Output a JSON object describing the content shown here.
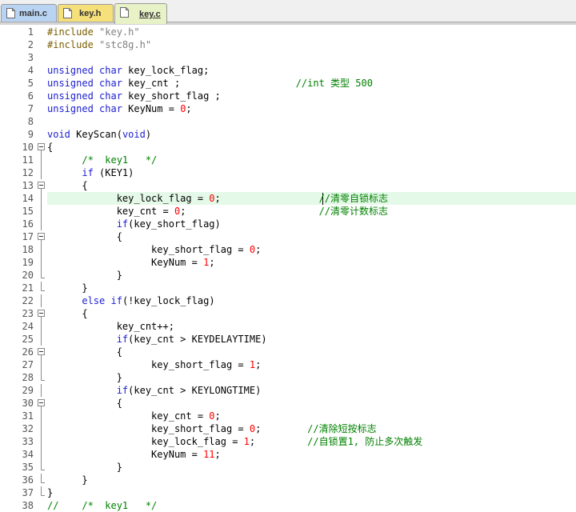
{
  "tabs": [
    {
      "label": "main.c",
      "color": "#b9d3f2",
      "active": false
    },
    {
      "label": "key.h",
      "color": "#f6e07a",
      "active": false
    },
    {
      "label": "key.c",
      "color": "#e7f2c6",
      "active": true
    }
  ],
  "current_line": 14,
  "colors": {
    "keyword": "#1e20d0",
    "preprocessor": "#7a5d00",
    "string": "#808080",
    "number": "#ff0000",
    "comment": "#008000",
    "current_line_bg": "#e5f9e8"
  },
  "code_lines": [
    {
      "n": "1",
      "fold": "",
      "text": "#include \"key.h\""
    },
    {
      "n": "2",
      "fold": "",
      "text": "#include \"stc8g.h\""
    },
    {
      "n": "3",
      "fold": "",
      "text": ""
    },
    {
      "n": "4",
      "fold": "",
      "text": "unsigned char key_lock_flag;"
    },
    {
      "n": "5",
      "fold": "",
      "text": "unsigned char key_cnt ;                    //int 类型 500"
    },
    {
      "n": "6",
      "fold": "",
      "text": "unsigned char key_short_flag ;"
    },
    {
      "n": "7",
      "fold": "",
      "text": "unsigned char KeyNum = 0;"
    },
    {
      "n": "8",
      "fold": "",
      "text": ""
    },
    {
      "n": "9",
      "fold": "",
      "text": "void KeyScan(void)"
    },
    {
      "n": "10",
      "fold": "open",
      "text": "{"
    },
    {
      "n": "11",
      "fold": "line",
      "text": "      /*  key1   */"
    },
    {
      "n": "12",
      "fold": "line",
      "text": "      if (KEY1)"
    },
    {
      "n": "13",
      "fold": "open",
      "text": "      {"
    },
    {
      "n": "14",
      "fold": "line",
      "text": "            key_lock_flag = 0;                 //清零自锁标志"
    },
    {
      "n": "15",
      "fold": "line",
      "text": "            key_cnt = 0;                       //清零计数标志"
    },
    {
      "n": "16",
      "fold": "line",
      "text": "            if(key_short_flag)"
    },
    {
      "n": "17",
      "fold": "open",
      "text": "            {"
    },
    {
      "n": "18",
      "fold": "line",
      "text": "                  key_short_flag = 0;"
    },
    {
      "n": "19",
      "fold": "line",
      "text": "                  KeyNum = 1;"
    },
    {
      "n": "20",
      "fold": "end",
      "text": "            }"
    },
    {
      "n": "21",
      "fold": "end",
      "text": "      }"
    },
    {
      "n": "22",
      "fold": "line",
      "text": "      else if(!key_lock_flag)"
    },
    {
      "n": "23",
      "fold": "open",
      "text": "      {"
    },
    {
      "n": "24",
      "fold": "line",
      "text": "            key_cnt++;"
    },
    {
      "n": "25",
      "fold": "line",
      "text": "            if(key_cnt > KEYDELAYTIME)"
    },
    {
      "n": "26",
      "fold": "open",
      "text": "            {"
    },
    {
      "n": "27",
      "fold": "line",
      "text": "                  key_short_flag = 1;"
    },
    {
      "n": "28",
      "fold": "end",
      "text": "            }"
    },
    {
      "n": "29",
      "fold": "line",
      "text": "            if(key_cnt > KEYLONGTIME)"
    },
    {
      "n": "30",
      "fold": "open",
      "text": "            {"
    },
    {
      "n": "31",
      "fold": "line",
      "text": "                  key_cnt = 0;"
    },
    {
      "n": "32",
      "fold": "line",
      "text": "                  key_short_flag = 0;        //清除短按标志"
    },
    {
      "n": "33",
      "fold": "line",
      "text": "                  key_lock_flag = 1;         //自锁置1, 防止多次触发"
    },
    {
      "n": "34",
      "fold": "line",
      "text": "                  KeyNum = 11;"
    },
    {
      "n": "35",
      "fold": "end",
      "text": "            }"
    },
    {
      "n": "36",
      "fold": "end",
      "text": "      }"
    },
    {
      "n": "37",
      "fold": "end",
      "text": "}"
    },
    {
      "n": "38",
      "fold": "",
      "text": "//    /*  key1   */"
    }
  ]
}
